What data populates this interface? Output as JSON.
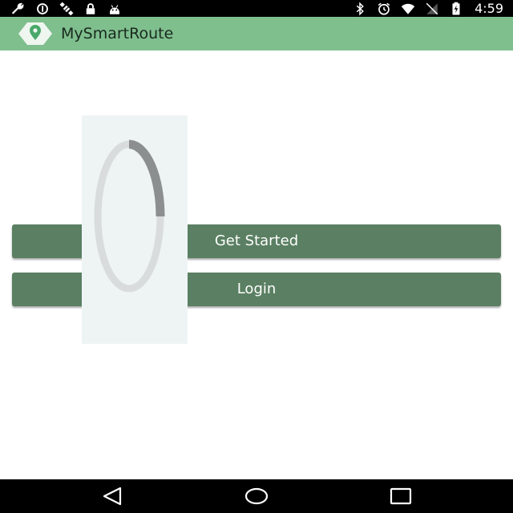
{
  "status_bar": {
    "time": "4:59",
    "left_icons": [
      "wrench-icon",
      "data-saver-icon",
      "no-signal-satellite-icon",
      "lock-icon",
      "android-icon"
    ],
    "right_icons": [
      "bluetooth-icon",
      "alarm-icon",
      "wifi-icon",
      "no-sim-icon",
      "battery-charging-icon"
    ]
  },
  "app_bar": {
    "title": "MySmartRoute",
    "logo_icon": "location-pin-icon",
    "background": "#7fbf8e"
  },
  "main": {
    "get_started_label": "Get Started",
    "login_label": "Login",
    "button_color": "#5a7f62"
  },
  "loading": {
    "icon": "circular-progress-icon",
    "progress": 0.25
  },
  "nav_bar": {
    "icons": [
      "back-icon",
      "home-icon",
      "recents-icon"
    ]
  }
}
